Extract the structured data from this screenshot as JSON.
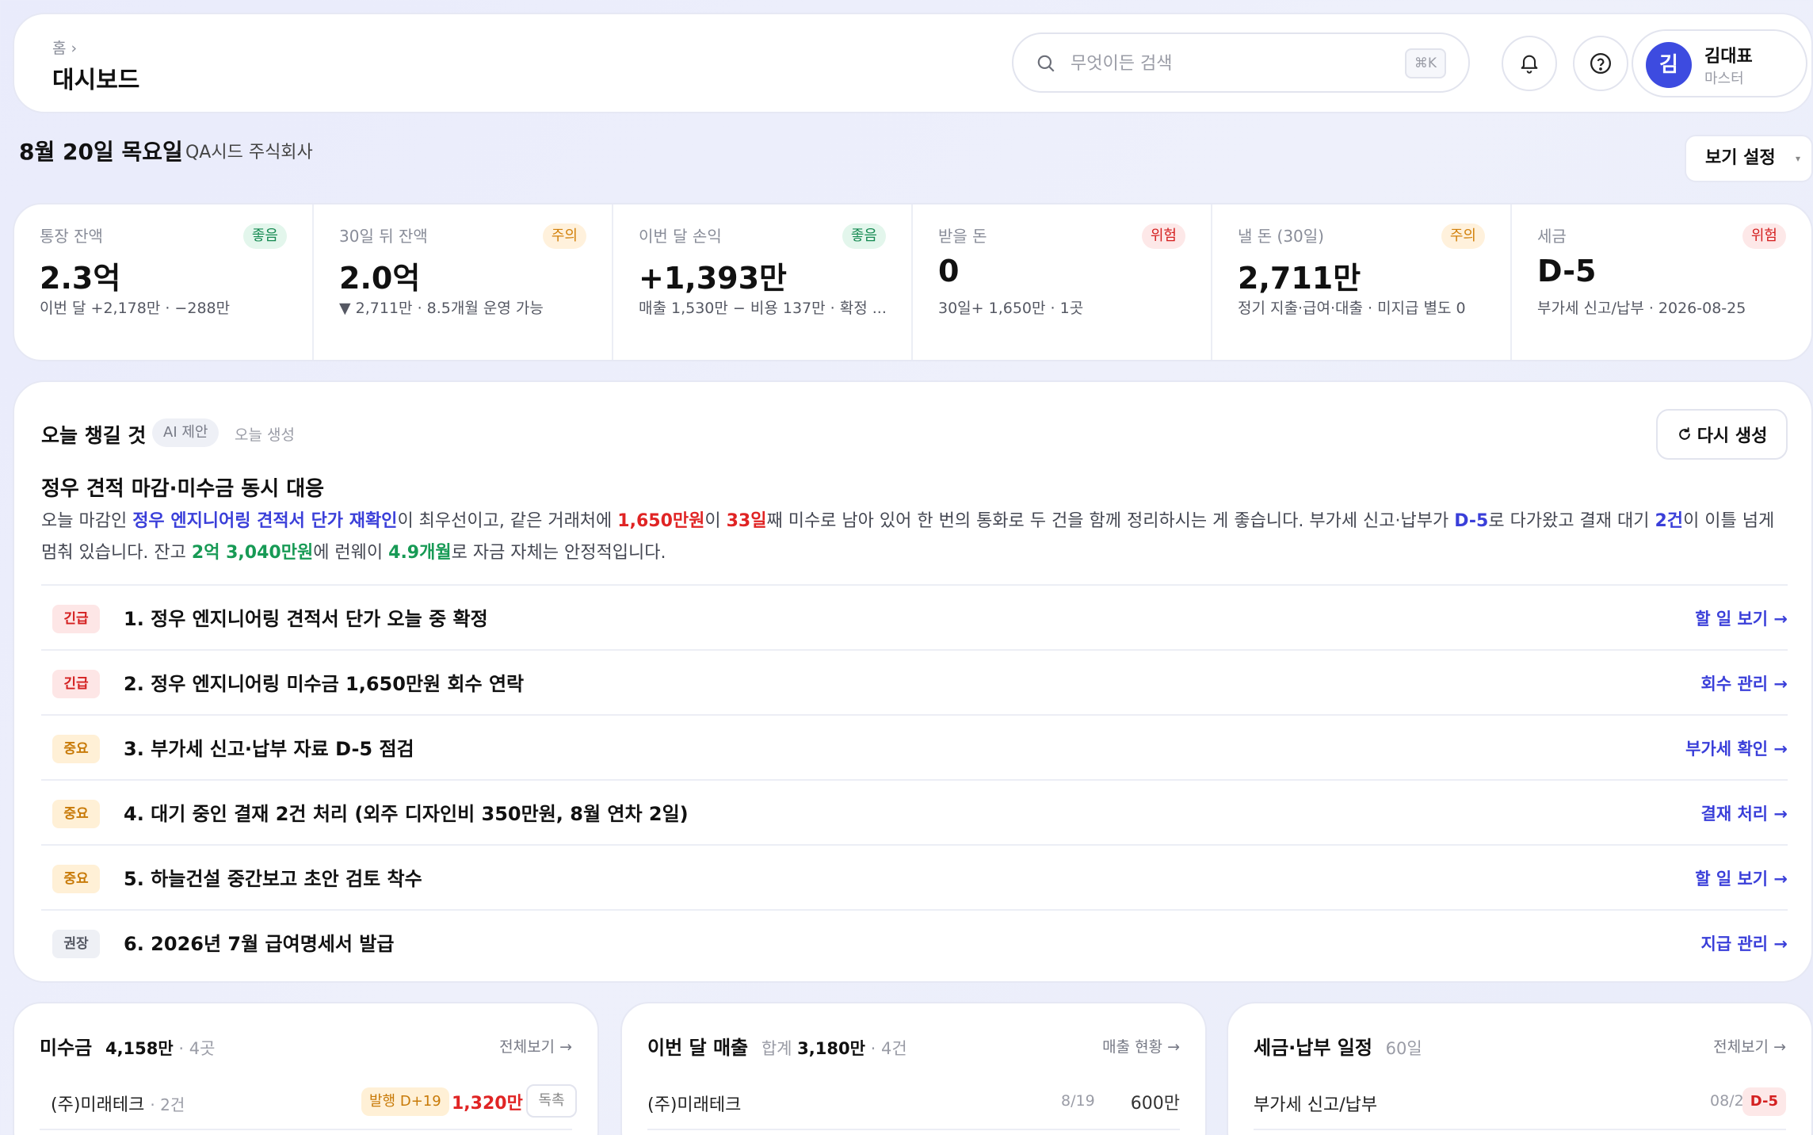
{
  "header": {
    "breadcrumb": "홈 ›",
    "title": "대시보드",
    "search_placeholder": "무엇이든 검색",
    "search_shortcut": "⌘K",
    "icons": [
      "bell-icon",
      "help-icon",
      "search-icon"
    ],
    "user": {
      "initial": "김",
      "name": "김대표",
      "role": "마스터"
    }
  },
  "date_row": {
    "date": "8월 20일 목요일",
    "company": "· QA시드 주식회사",
    "view_setting": "보기 설정",
    "caret": "▾"
  },
  "kpis": [
    {
      "label": "통장 잔액",
      "badge": "좋음",
      "status": "good",
      "value": "2.3억",
      "sub": "이번 달 +2,178만 · −288만"
    },
    {
      "label": "30일 뒤 잔액",
      "badge": "주의",
      "status": "warn",
      "value": "2.0억",
      "sub": "▼ 2,711만 · 8.5개월 운영 가능"
    },
    {
      "label": "이번 달 손익",
      "badge": "좋음",
      "status": "good",
      "value": "+1,393만",
      "sub": "매출 1,530만 − 비용 137만 · 확정 ..."
    },
    {
      "label": "받을 돈",
      "badge": "위험",
      "status": "bad",
      "value": "0",
      "sub": "30일+ 1,650만 · 1곳"
    },
    {
      "label": "낼 돈 (30일)",
      "badge": "주의",
      "status": "warn",
      "value": "2,711만",
      "sub": "정기 지출·급여·대출 · 미지급 별도 0"
    },
    {
      "label": "세금",
      "badge": "위험",
      "status": "bad",
      "value": "D-5",
      "sub": "부가세 신고/납부 · 2026-08-25"
    }
  ],
  "today": {
    "title": "오늘 챙길 것",
    "ai_tag": "AI 제안",
    "generated": "오늘 생성",
    "regen_label": "다시 생성",
    "headline": "정우 견적 마감·미수금 동시 대응",
    "summary": {
      "p1": "오늘 마감인 ",
      "h1": "정우 엔지니어링 견적서 단가 재확인",
      "p2": "이 최우선이고, 같은 거래처에 ",
      "h2": "1,650만원",
      "p3": "이 ",
      "h3": "33일",
      "p4": "째 미수로 남아 있어 한 번의 통화로 두 건을 함께 정리하시는 게 좋습니다. 부가세 신고·납부가 ",
      "h4": "D-5",
      "p5": "로 다가왔고 결재 대기 ",
      "h5": "2건",
      "p6": "이 이틀 넘게 멈춰 있습니다. 잔고 ",
      "h6": "2억 3,040만원",
      "p7": "에 런웨이 ",
      "h7": "4.9개월",
      "p8": "로 자금 자체는 안정적입니다."
    },
    "tasks": [
      {
        "tag": "긴급",
        "level": "urgent",
        "text": "1. 정우 엔지니어링 견적서 단가 오늘 중 확정",
        "link": "할 일 보기 →"
      },
      {
        "tag": "긴급",
        "level": "urgent",
        "text": "2. 정우 엔지니어링 미수금 1,650만원 회수 연락",
        "link": "회수 관리 →"
      },
      {
        "tag": "중요",
        "level": "imp",
        "text": "3. 부가세 신고·납부 자료 D-5 점검",
        "link": "부가세 확인 →"
      },
      {
        "tag": "중요",
        "level": "imp",
        "text": "4. 대기 중인 결재 2건 처리 (외주 디자인비 350만원, 8월 연차 2일)",
        "link": "결재 처리 →"
      },
      {
        "tag": "중요",
        "level": "imp",
        "text": "5. 하늘건설 중간보고 초안 검토 착수",
        "link": "할 일 보기 →"
      },
      {
        "tag": "권장",
        "level": "rec",
        "text": "6. 2026년 7월 급여명세서 발급",
        "link": "지급 관리 →"
      }
    ]
  },
  "receivables": {
    "title": "미수금",
    "total": "4,158만",
    "count": "· 4곳",
    "link": "전체보기 →",
    "rows": [
      {
        "name": "(주)미래테크",
        "sub": "· 2건",
        "badge": "발행 D+19",
        "amount": "1,320만",
        "action": "독촉"
      }
    ]
  },
  "sales": {
    "title": "이번 달 매출",
    "total_label": "합계",
    "total": "3,180만",
    "count": "· 4건",
    "link": "매출 현황 →",
    "rows": [
      {
        "name": "(주)미래테크",
        "date": "8/19",
        "amount": "600만"
      }
    ]
  },
  "tax": {
    "title": "세금·납부 일정",
    "period": "60일",
    "link": "전체보기 →",
    "rows": [
      {
        "name": "부가세 신고/납부",
        "date": "08/25",
        "dday": "D-5"
      }
    ]
  }
}
